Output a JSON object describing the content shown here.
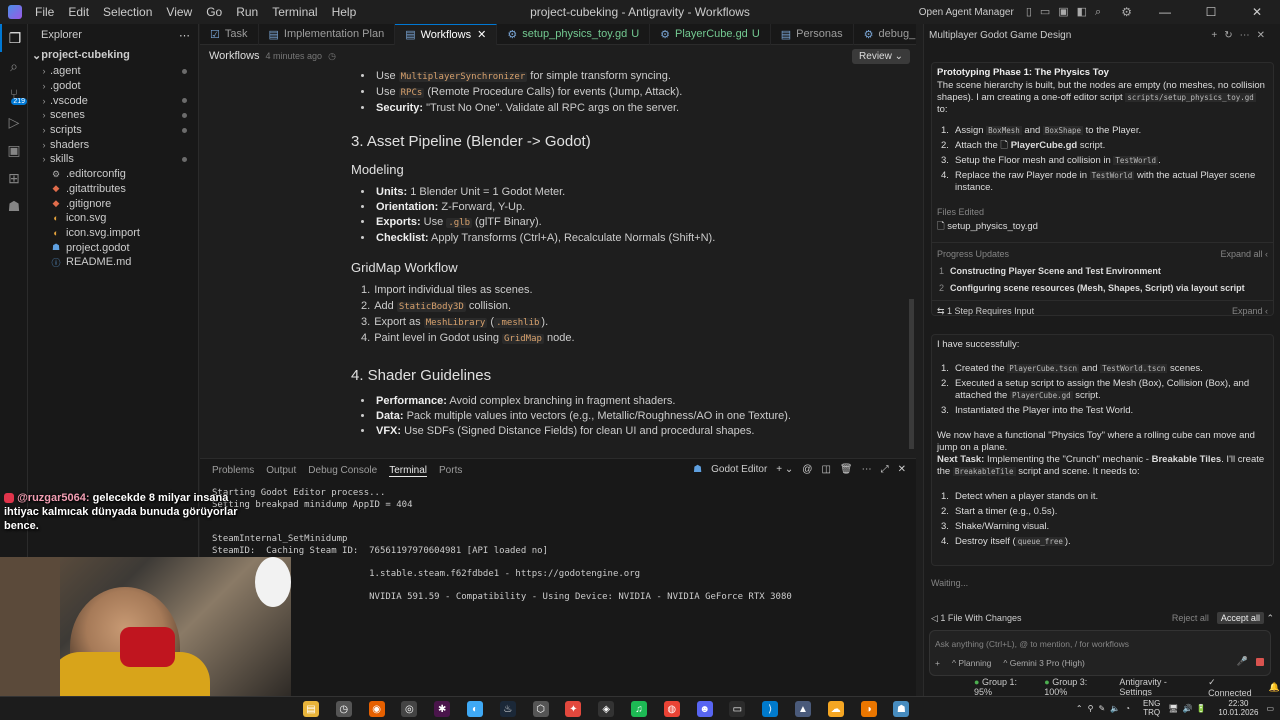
{
  "window": {
    "menu": [
      "File",
      "Edit",
      "Selection",
      "View",
      "Go",
      "Run",
      "Terminal",
      "Help"
    ],
    "title": "project-cubeking - Antigravity - Workflows",
    "open_agent_manager": "Open Agent Manager"
  },
  "explorer": {
    "header": "Explorer",
    "root": "project-cubeking",
    "folders": [
      ".agent",
      ".godot",
      ".vscode",
      "scenes",
      "scripts",
      "shaders",
      "skills"
    ],
    "files": [
      ".editorconfig",
      ".gitattributes",
      ".gitignore",
      "icon.svg",
      "icon.svg.import",
      "project.godot",
      "README.md"
    ]
  },
  "activity_badge": "219",
  "tabs": [
    {
      "label": "Task",
      "active": false,
      "mod": ""
    },
    {
      "label": "Implementation Plan",
      "active": false,
      "mod": ""
    },
    {
      "label": "Workflows",
      "active": true,
      "mod": ""
    },
    {
      "label": "setup_physics_toy.gd",
      "active": false,
      "mod": "U"
    },
    {
      "label": "PlayerCube.gd",
      "active": false,
      "mod": "U"
    },
    {
      "label": "Personas",
      "active": false,
      "mod": ""
    },
    {
      "label": "debug_",
      "active": false,
      "mod": ""
    }
  ],
  "breadcrumb": {
    "title": "Workflows",
    "time": "4 minutes ago",
    "review": "Review"
  },
  "doc": {
    "top_items": [
      {
        "pre": "Use ",
        "code": "MultiplayerSynchronizer",
        "post": " for simple transform syncing."
      },
      {
        "pre": "Use ",
        "code": "RPCs",
        "post": " (Remote Procedure Calls) for events (Jump, Attack)."
      },
      {
        "bold": "Security:",
        "post": " \"Trust No One\". Validate all RPC args on the server."
      }
    ],
    "h2_asset": "3. Asset Pipeline (Blender -> Godot)",
    "h3_modeling": "Modeling",
    "modeling": [
      {
        "bold": "Units:",
        "post": " 1 Blender Unit = 1 Godot Meter."
      },
      {
        "bold": "Orientation:",
        "post": " Z-Forward, Y-Up."
      },
      {
        "bold": "Exports:",
        "pre": " Use ",
        "code": ".glb",
        "post": " (glTF Binary)."
      },
      {
        "bold": "Checklist:",
        "post": " Apply Transforms (Ctrl+A), Recalculate Normals (Shift+N)."
      }
    ],
    "h3_gridmap": "GridMap Workflow",
    "gridmap": [
      {
        "num": "1.",
        "pre": "Import individual tiles as scenes."
      },
      {
        "num": "2.",
        "pre": "Add ",
        "code": "StaticBody3D",
        "post": " collision."
      },
      {
        "num": "3.",
        "pre": "Export as ",
        "code": "MeshLibrary",
        "mid": " (",
        "code2": ".meshlib",
        "post": ")."
      },
      {
        "num": "4.",
        "pre": "Paint level in Godot using ",
        "code": "GridMap",
        "post": " node."
      }
    ],
    "h2_shader": "4. Shader Guidelines",
    "shader": [
      {
        "bold": "Performance:",
        "post": " Avoid complex branching in fragment shaders."
      },
      {
        "bold": "Data:",
        "post": " Pack multiple values into vectors (e.g., Metallic/Roughness/AO in one Texture)."
      },
      {
        "bold": "VFX:",
        "post": " Use SDFs (Signed Distance Fields) for clean UI and procedural shapes."
      }
    ]
  },
  "panel": {
    "tabs": [
      "Problems",
      "Output",
      "Debug Console",
      "Terminal",
      "Ports"
    ],
    "active": "Terminal",
    "godot_editor": "Godot Editor",
    "lines": [
      "Starting Godot Editor process...",
      "Setting breakpad minidump AppID = 404",
      "",
      "",
      "SteamInternal_SetMinidump",
      "SteamID:  Caching Steam ID:  76561197970604981 [API loaded no]",
      "",
      "                             1.stable.steam.f62fdbde1 - https://godotengine.org",
      "",
      "                             NVIDIA 591.59 - Compatibility - Using Device: NVIDIA - NVIDIA GeForce RTX 3080"
    ]
  },
  "chat_overlay": {
    "user": "@ruzgar5064:",
    "message": "gelecekde 8 milyar insana ihtiyac kalmıcak dünyada bunuda görüyorlar bence."
  },
  "agent": {
    "header": "Multiplayer Godot Game Design",
    "phase_title": "Prototyping Phase 1: The Physics Toy",
    "phase_desc_a": "The scene hierarchy is built, but the nodes are empty (no meshes, no collision shapes). I am creating a one-off editor script ",
    "phase_desc_code": "scripts/setup_physics_toy.gd",
    "phase_desc_b": " to:",
    "steps": [
      {
        "n": "1.",
        "pre": "Assign ",
        "c1": "BoxMesh",
        "mid": " and ",
        "c2": "BoxShape",
        "post": " to the Player."
      },
      {
        "n": "2.",
        "pre": "Attach the ",
        "file": "PlayerCube.gd",
        "post": " script."
      },
      {
        "n": "3.",
        "pre": "Setup the Floor mesh and collision in ",
        "c1": "TestWorld",
        "post": "."
      },
      {
        "n": "4.",
        "pre": "Replace the raw Player node in ",
        "c1": "TestWorld",
        "post": " with the actual Player scene instance."
      }
    ],
    "files_edited_label": "Files Edited",
    "file_edited": "setup_physics_toy.gd",
    "progress_label": "Progress Updates",
    "expand_all": "Expand all",
    "progress": [
      {
        "n": "1",
        "text": "Constructing Player Scene and Test Environment"
      },
      {
        "n": "2",
        "text": "Configuring scene resources (Mesh, Shapes, Script) via layout script"
      }
    ],
    "requires_input": "1 Step Requires Input",
    "expand": "Expand",
    "success_intro": "I have successfully:",
    "success": [
      {
        "n": "1.",
        "pre": "Created the ",
        "c1": "PlayerCube.tscn",
        "mid": " and ",
        "c2": "TestWorld.tscn",
        "post": " scenes."
      },
      {
        "n": "2.",
        "pre": "Executed a setup script to assign the Mesh (Box), Collision (Box), and attached the ",
        "c1": "PlayerCube.gd",
        "post": " script."
      },
      {
        "n": "3.",
        "pre": "Instantiated the Player into the Test World."
      }
    ],
    "summary": "We now have a functional \"Physics Toy\" where a rolling cube can move and jump on a plane.",
    "next_task_label": "Next Task:",
    "next_task_a": " Implementing the \"Crunch\" mechanic - ",
    "next_task_bold": "Breakable Tiles",
    "next_task_b": ". I'll create the ",
    "next_task_code": "BreakableTile",
    "next_task_c": " script and scene. It needs to:",
    "needs": [
      {
        "n": "1.",
        "pre": "Detect when a player stands on it."
      },
      {
        "n": "2.",
        "pre": "Start a timer (e.g., 0.5s)."
      },
      {
        "n": "3.",
        "pre": "Shake/Warning visual."
      },
      {
        "n": "4.",
        "pre": "Destroy itself (",
        "c1": "queue_free",
        "post": ")."
      }
    ],
    "waiting": "Waiting...",
    "changes": "1 File With Changes",
    "reject_all": "Reject all",
    "accept_all": "Accept all",
    "input_placeholder": "Ask anything (Ctrl+L), @ to mention, / for workflows",
    "mode": "Planning",
    "model": "Gemini 3 Pro (High)"
  },
  "statusbar": {
    "group1": "Group 1: 95%",
    "group3": "Group 3: 100%",
    "settings": "Antigravity - Settings",
    "connected": "Connected"
  },
  "taskbar": {
    "lang1": "ENG",
    "lang2": "TRQ",
    "time": "22:30",
    "date": "10.01.2026"
  },
  "colors": {
    "accent": "#0078d4",
    "status_green": "#4caf50",
    "accept": "#3c3c3c"
  }
}
